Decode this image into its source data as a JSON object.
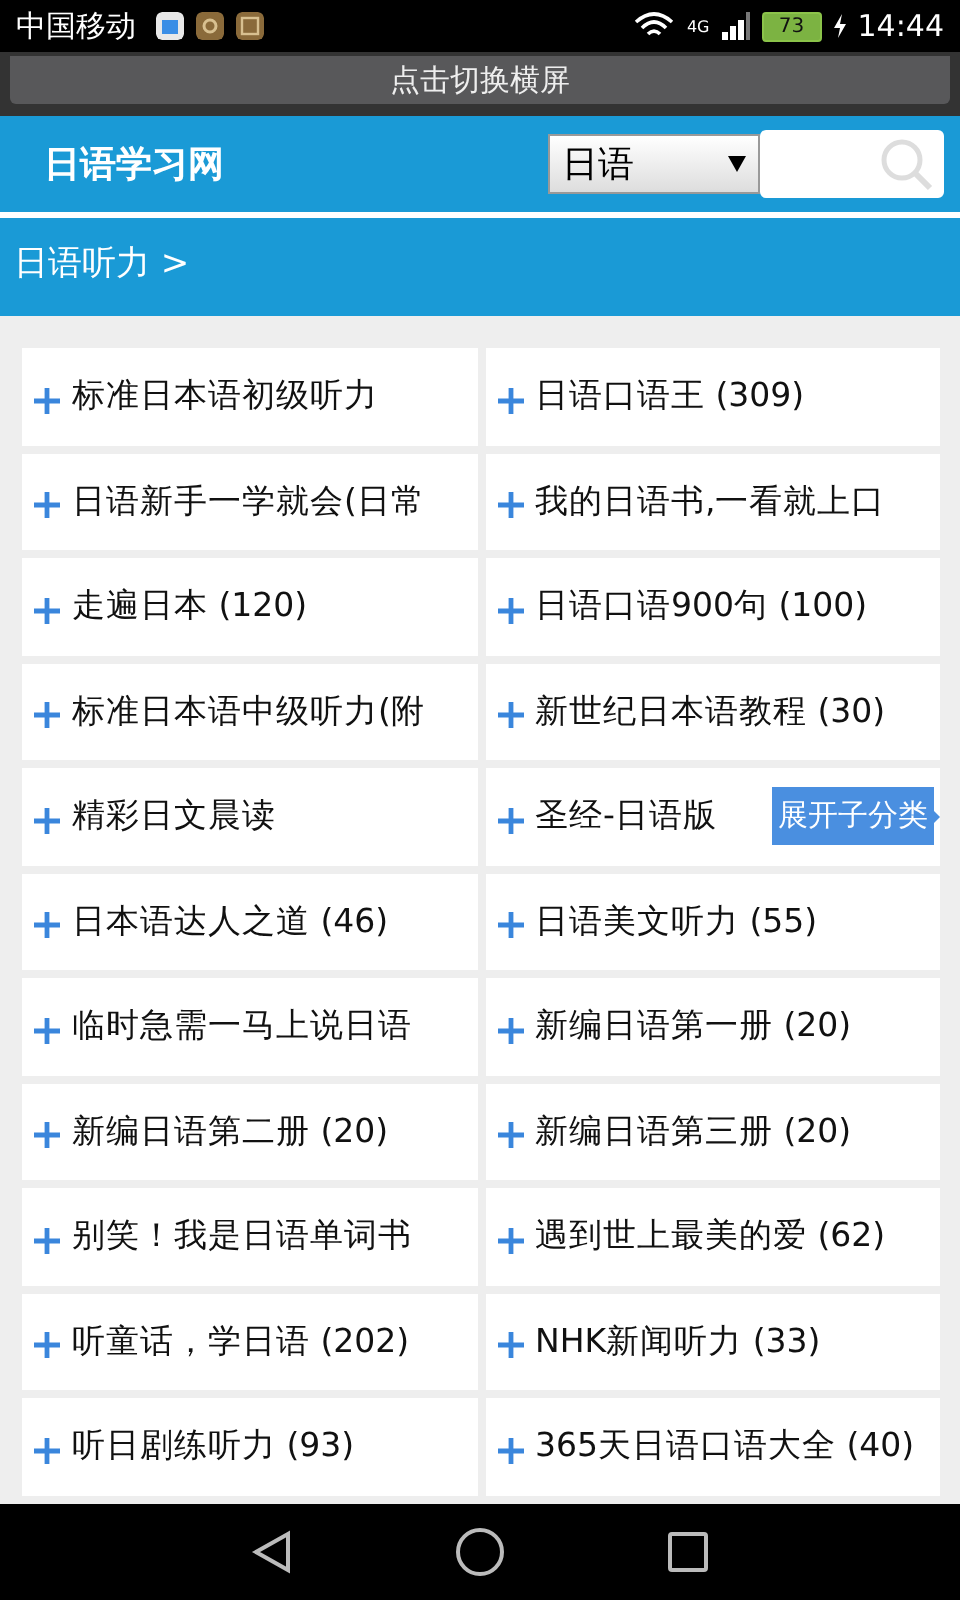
{
  "status_bar": {
    "carrier": "中国移动",
    "network": "4G",
    "battery": "73",
    "time": "14:44"
  },
  "banner": {
    "text": "点击切换横屏"
  },
  "header": {
    "title": "日语学习网",
    "select": {
      "value": "日语"
    }
  },
  "breadcrumb": {
    "text": "日语听力 >"
  },
  "categories": [
    {
      "label": "标准日本语初级听力"
    },
    {
      "label": "日语口语王 (309)"
    },
    {
      "label": "日语新手一学就会(日常"
    },
    {
      "label": "我的日语书,一看就上口"
    },
    {
      "label": "走遍日本 (120)"
    },
    {
      "label": "日语口语900句 (100)"
    },
    {
      "label": "标准日本语中级听力(附"
    },
    {
      "label": "新世纪日本语教程 (30)"
    },
    {
      "label": "精彩日文晨读"
    },
    {
      "label": "圣经-日语版",
      "tooltip": "展开子分类"
    },
    {
      "label": "日本语达人之道 (46)"
    },
    {
      "label": "日语美文听力 (55)"
    },
    {
      "label": "临时急需一马上说日语"
    },
    {
      "label": "新编日语第一册 (20)"
    },
    {
      "label": "新编日语第二册 (20)"
    },
    {
      "label": "新编日语第三册 (20)"
    },
    {
      "label": "别笑！我是日语单词书"
    },
    {
      "label": "遇到世上最美的爱 (62)"
    },
    {
      "label": "听童话，学日语 (202)"
    },
    {
      "label": "NHK新闻听力 (33)"
    },
    {
      "label": "听日剧练听力 (93)"
    },
    {
      "label": "365天日语口语大全 (40)"
    }
  ]
}
